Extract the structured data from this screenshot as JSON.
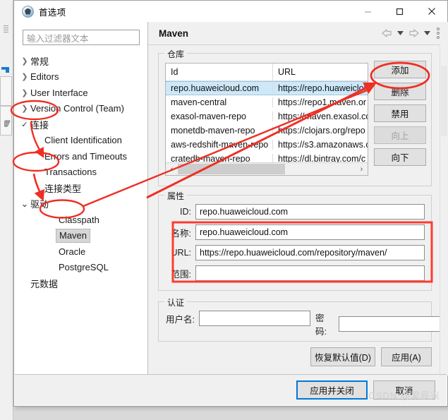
{
  "window": {
    "title": "首选项",
    "icon": "preferences-icon",
    "minimize": "minimize-icon",
    "maximize": "maximize-icon",
    "close": "close-icon"
  },
  "sidebar": {
    "filter": {
      "placeholder": "输入过滤器文本",
      "value": ""
    },
    "items": [
      {
        "label": "常规",
        "indent": 0,
        "twisty": "collapsed"
      },
      {
        "label": "Editors",
        "indent": 0,
        "twisty": "collapsed"
      },
      {
        "label": "User Interface",
        "indent": 0,
        "twisty": "collapsed"
      },
      {
        "label": "Version Control (Team)",
        "indent": 0,
        "twisty": "collapsed"
      },
      {
        "label": "连接",
        "indent": 0,
        "twisty": "check"
      },
      {
        "label": "Client Identification",
        "indent": 1,
        "twisty": "none"
      },
      {
        "label": "Errors and Timeouts",
        "indent": 1,
        "twisty": "none"
      },
      {
        "label": "Transactions",
        "indent": 1,
        "twisty": "none"
      },
      {
        "label": "连接类型",
        "indent": 1,
        "twisty": "none"
      },
      {
        "label": "驱动",
        "indent": 0,
        "twisty": "expanded"
      },
      {
        "label": "Classpath",
        "indent": 2,
        "twisty": "none"
      },
      {
        "label": "Maven",
        "indent": 2,
        "twisty": "none",
        "selected": true
      },
      {
        "label": "Oracle",
        "indent": 2,
        "twisty": "none"
      },
      {
        "label": "PostgreSQL",
        "indent": 2,
        "twisty": "none"
      },
      {
        "label": "元数据",
        "indent": 0,
        "twisty": "none"
      }
    ]
  },
  "main": {
    "title": "Maven",
    "nav": {
      "back_icon": "arrow-left-icon",
      "back_caret_icon": "chevron-down-icon",
      "forward_icon": "arrow-right-icon",
      "forward_caret_icon": "chevron-down-icon",
      "menu_icon": "kebab-menu-icon"
    },
    "repositories": {
      "legend": "仓库",
      "columns": [
        "Id",
        "URL"
      ],
      "rows": [
        {
          "id": "repo.huaweicloud.com",
          "url": "https://repo.huaweiclou",
          "selected": true
        },
        {
          "id": "maven-central",
          "url": "https://repo1.maven.or",
          "selected": false
        },
        {
          "id": "exasol-maven-repo",
          "url": "https://maven.exasol.cc",
          "selected": false
        },
        {
          "id": "monetdb-maven-repo",
          "url": "https://clojars.org/repo",
          "selected": false
        },
        {
          "id": "aws-redshift-maven-repo",
          "url": "https://s3.amazonaws.c",
          "selected": false
        },
        {
          "id": "cratedb-maven-repo",
          "url": "https://dl.bintray.com/c",
          "selected": false
        }
      ],
      "hscroll": {
        "left_icon": "chevron-left-icon",
        "right_icon": "chevron-right-icon"
      },
      "buttons": [
        {
          "label": "添加",
          "disabled": false
        },
        {
          "label": "删除",
          "disabled": false
        },
        {
          "label": "禁用",
          "disabled": false
        },
        {
          "label": "向上",
          "disabled": true
        },
        {
          "label": "向下",
          "disabled": false
        }
      ]
    },
    "properties": {
      "legend": "属性",
      "fields": [
        {
          "label": "ID:",
          "value": "repo.huaweicloud.com"
        },
        {
          "label": "名称:",
          "value": "repo.huaweicloud.com"
        },
        {
          "label": "URL:",
          "value": "https://repo.huaweicloud.com/repository/maven/"
        },
        {
          "label": "范围:",
          "value": ""
        }
      ]
    },
    "auth": {
      "legend": "认证",
      "username_label": "用户名:",
      "username_value": "",
      "password_label": "密码:",
      "password_value": ""
    },
    "panel_buttons": {
      "restore_defaults": "恢复默认值(D)",
      "restore_defaults_mnemonic": "D",
      "apply": "应用(A)",
      "apply_mnemonic": "A"
    }
  },
  "footer": {
    "apply_and_close": "应用并关闭",
    "cancel": "取消",
    "watermark": "CSDN @梁辰兴"
  },
  "annotations": {
    "accent_color": "#ef2e24",
    "highlight_color": "#ff3b30",
    "ellipses": [
      "连接",
      "驱动",
      "Maven",
      "添加"
    ],
    "boxes": [
      "属性-ID-名称-URL"
    ],
    "arrows": [
      "连接→连接类型",
      "驱动→Maven",
      "Maven→添加"
    ]
  }
}
